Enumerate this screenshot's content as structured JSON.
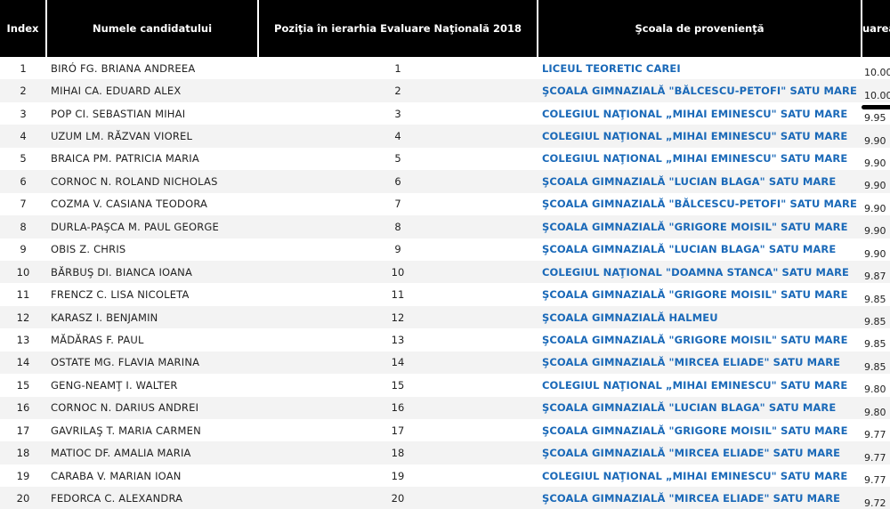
{
  "headers": {
    "index": "Index",
    "name": "Numele candidatului",
    "rank": "Poziţia în ierarhia Evaluare Naţională 2018",
    "school": "Şcoala de provenienţă",
    "score": "uarea"
  },
  "colors": {
    "header_bg": "#000000",
    "link": "#1a69b8",
    "row_alt": "#f3f3f3"
  },
  "rows": [
    {
      "index": "1",
      "name": "BIRÓ FG. BRIANA ANDREEA",
      "rank": "1",
      "school": "LICEUL TEORETIC CAREI",
      "score": "10.00"
    },
    {
      "index": "2",
      "name": "MIHAI CA. EDUARD ALEX",
      "rank": "2",
      "school": "ŞCOALA GIMNAZIALĂ \"BĂLCESCU-PETOFI\" SATU MARE",
      "score": "10.00"
    },
    {
      "index": "3",
      "name": "POP CI. SEBASTIAN MIHAI",
      "rank": "3",
      "school": "COLEGIUL NAŢIONAL „MIHAI EMINESCU\" SATU MARE",
      "score": "9.95"
    },
    {
      "index": "4",
      "name": "UZUM LM. RĂZVAN VIOREL",
      "rank": "4",
      "school": "COLEGIUL NAŢIONAL „MIHAI EMINESCU\" SATU MARE",
      "score": "9.90"
    },
    {
      "index": "5",
      "name": "BRAICA PM. PATRICIA MARIA",
      "rank": "5",
      "school": "COLEGIUL NAŢIONAL „MIHAI EMINESCU\" SATU MARE",
      "score": "9.90"
    },
    {
      "index": "6",
      "name": "CORNOC N. ROLAND NICHOLAS",
      "rank": "6",
      "school": "ŞCOALA GIMNAZIALĂ \"LUCIAN BLAGA\" SATU MARE",
      "score": "9.90"
    },
    {
      "index": "7",
      "name": "COZMA V. CASIANA TEODORA",
      "rank": "7",
      "school": "ŞCOALA GIMNAZIALĂ \"BĂLCESCU-PETOFI\" SATU MARE",
      "score": "9.90"
    },
    {
      "index": "8",
      "name": "DURLA-PAŞCA M. PAUL GEORGE",
      "rank": "8",
      "school": "ŞCOALA GIMNAZIALĂ \"GRIGORE MOISIL\" SATU MARE",
      "score": "9.90"
    },
    {
      "index": "9",
      "name": "OBIS Z. CHRIS",
      "rank": "9",
      "school": "ŞCOALA GIMNAZIALĂ \"LUCIAN BLAGA\" SATU MARE",
      "score": "9.90"
    },
    {
      "index": "10",
      "name": "BĂRBUŞ DI. BIANCA IOANA",
      "rank": "10",
      "school": "COLEGIUL NAŢIONAL \"DOAMNA STANCA\" SATU MARE",
      "score": "9.87"
    },
    {
      "index": "11",
      "name": "FRENCZ C. LISA NICOLETA",
      "rank": "11",
      "school": "ŞCOALA GIMNAZIALĂ \"GRIGORE MOISIL\" SATU MARE",
      "score": "9.85"
    },
    {
      "index": "12",
      "name": "KARASZ I. BENJAMIN",
      "rank": "12",
      "school": "ŞCOALA GIMNAZIALĂ HALMEU",
      "score": "9.85"
    },
    {
      "index": "13",
      "name": "MĂDĂRAS F. PAUL",
      "rank": "13",
      "school": "ŞCOALA GIMNAZIALĂ \"GRIGORE MOISIL\" SATU MARE",
      "score": "9.85"
    },
    {
      "index": "14",
      "name": "OSTATE MG. FLAVIA MARINA",
      "rank": "14",
      "school": "ŞCOALA GIMNAZIALĂ \"MIRCEA ELIADE\" SATU MARE",
      "score": "9.85"
    },
    {
      "index": "15",
      "name": "GENG-NEAMŢ I. WALTER",
      "rank": "15",
      "school": "COLEGIUL NAŢIONAL „MIHAI EMINESCU\" SATU MARE",
      "score": "9.80"
    },
    {
      "index": "16",
      "name": "CORNOC N. DARIUS ANDREI",
      "rank": "16",
      "school": "ŞCOALA GIMNAZIALĂ \"LUCIAN BLAGA\" SATU MARE",
      "score": "9.80"
    },
    {
      "index": "17",
      "name": "GAVRILAŞ T. MARIA CARMEN",
      "rank": "17",
      "school": "ŞCOALA GIMNAZIALĂ \"GRIGORE MOISIL\" SATU MARE",
      "score": "9.77"
    },
    {
      "index": "18",
      "name": "MATIOC DF. AMALIA MARIA",
      "rank": "18",
      "school": "ŞCOALA GIMNAZIALĂ \"MIRCEA ELIADE\" SATU MARE",
      "score": "9.77"
    },
    {
      "index": "19",
      "name": "CARABA V. MARIAN IOAN",
      "rank": "19",
      "school": "COLEGIUL NAŢIONAL „MIHAI EMINESCU\" SATU MARE",
      "score": "9.77"
    },
    {
      "index": "20",
      "name": "FEDORCA C. ALEXANDRA",
      "rank": "20",
      "school": "ŞCOALA GIMNAZIALĂ \"MIRCEA ELIADE\" SATU MARE",
      "score": "9.72"
    }
  ]
}
